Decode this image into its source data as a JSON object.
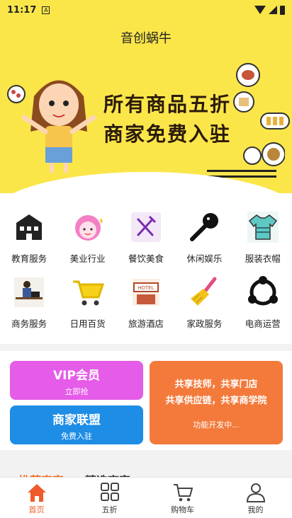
{
  "status_bar": {
    "time": "11:17",
    "sim_badge": "A"
  },
  "header": {
    "title": "音创蜗牛"
  },
  "banner": {
    "line1": "所有商品五折",
    "line2": "商家免费入驻",
    "dots": 2,
    "active_dot": 0
  },
  "categories": [
    {
      "label": "教育服务",
      "icon": "school-building-icon"
    },
    {
      "label": "美业行业",
      "icon": "beauty-face-icon"
    },
    {
      "label": "餐饮美食",
      "icon": "fork-knife-icon"
    },
    {
      "label": "休闲娱乐",
      "icon": "microphone-icon"
    },
    {
      "label": "服装衣帽",
      "icon": "tshirt-icon"
    },
    {
      "label": "商务服务",
      "icon": "office-worker-icon"
    },
    {
      "label": "日用百货",
      "icon": "shopping-cart-icon"
    },
    {
      "label": "旅游酒店",
      "icon": "hotel-sign-icon"
    },
    {
      "label": "家政服务",
      "icon": "broom-icon"
    },
    {
      "label": "电商运营",
      "icon": "network-icon"
    }
  ],
  "promo": {
    "vip": {
      "title": "VIP会员",
      "subtitle": "立即抢"
    },
    "merchant": {
      "title": "商家联盟",
      "subtitle": "免费入驻"
    },
    "share": {
      "line1": "共享技师，共享门店",
      "line2": "共享供应链，共享商学院",
      "note": "功能开发中..."
    }
  },
  "section_tabs": [
    "推荐商家",
    "精选商家"
  ],
  "bottom_nav": [
    {
      "label": "首页",
      "icon": "home-icon",
      "active": true
    },
    {
      "label": "五折",
      "icon": "grid-icon",
      "active": false
    },
    {
      "label": "购物车",
      "icon": "cart-icon",
      "active": false
    },
    {
      "label": "我的",
      "icon": "user-icon",
      "active": false
    }
  ],
  "colors": {
    "banner": "#fbe64a",
    "accent": "#f05a2a",
    "vip": "#e55ce8",
    "merchant": "#1e8de6",
    "share": "#f37a3a"
  }
}
